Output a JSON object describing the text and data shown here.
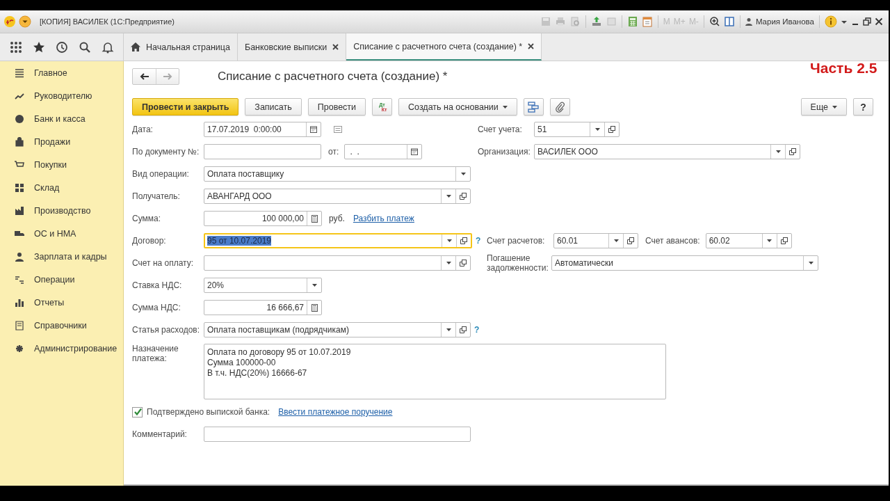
{
  "app": {
    "title": "[КОПИЯ] ВАСИЛЕК  (1С:Предприятие)",
    "memory": [
      "M",
      "M+",
      "M-"
    ],
    "user": "Мария Иванова"
  },
  "tabs": [
    {
      "label": "Начальная страница",
      "selected": false,
      "kind": "home"
    },
    {
      "label": "Банковские выписки",
      "selected": false,
      "kind": "closable"
    },
    {
      "label": "Списание с расчетного счета (создание) *",
      "selected": true,
      "kind": "closable"
    }
  ],
  "sidebar": {
    "items": [
      "Главное",
      "Руководителю",
      "Банк и касса",
      "Продажи",
      "Покупки",
      "Склад",
      "Производство",
      "ОС и НМА",
      "Зарплата и кадры",
      "Операции",
      "Отчеты",
      "Справочники",
      "Администрирование"
    ]
  },
  "overlay_caption": "Часть 2.5",
  "form": {
    "title": "Списание с расчетного счета (создание) *",
    "toolbar": [
      {
        "kind": "primary",
        "label": "Провести и закрыть"
      },
      {
        "kind": "button",
        "label": "Записать"
      },
      {
        "kind": "button",
        "label": "Провести"
      },
      {
        "kind": "dtkt",
        "top": "Дт",
        "bottom": "Кт"
      },
      {
        "kind": "menu",
        "label": "Создать на основании"
      },
      {
        "kind": "structure"
      },
      {
        "kind": "attach"
      }
    ],
    "toolbar_right": [
      {
        "kind": "menu",
        "label": "Еще"
      },
      {
        "kind": "button",
        "label": "?"
      }
    ],
    "rows": [
      {
        "left": [
          {
            "kind": "label",
            "text": "Дата:"
          },
          {
            "kind": "date",
            "value": "17.07.2019  0:00:00",
            "focused": false
          },
          {
            "kind": "note_icon"
          }
        ],
        "right": [
          {
            "kind": "label",
            "text": "Счет учета:"
          },
          {
            "kind": "reference",
            "value": "51",
            "focused": false
          }
        ]
      },
      {
        "left": [
          {
            "kind": "label",
            "text": "По документу №:"
          },
          {
            "kind": "text",
            "focused": false
          },
          {
            "kind": "label",
            "text": "от:"
          },
          {
            "kind": "date",
            "value": " .  . ",
            "focused": false
          }
        ],
        "right": [
          {
            "kind": "label",
            "text": "Организация:"
          },
          {
            "kind": "reference",
            "value": "ВАСИЛЕК ООО",
            "focused": false
          }
        ]
      },
      {
        "left": [
          {
            "kind": "label",
            "text": "Вид операции:"
          },
          {
            "kind": "select",
            "value": "Оплата поставщику",
            "focused": false
          }
        ]
      },
      {
        "left": [
          {
            "kind": "label",
            "text": "Получатель:"
          },
          {
            "kind": "reference",
            "value": "АВАНГАРД ООО",
            "focused": false
          }
        ]
      },
      {
        "left": [
          {
            "kind": "label",
            "text": "Сумма:"
          },
          {
            "kind": "number",
            "value": "100 000,00",
            "focused": false
          },
          {
            "kind": "unit",
            "text": "руб."
          },
          {
            "kind": "link",
            "text": "Разбить платеж"
          }
        ]
      },
      {
        "left": [
          {
            "kind": "label",
            "text": "Договор:"
          },
          {
            "kind": "reference",
            "value": "95 от 10.07.2019",
            "focused": true
          },
          {
            "kind": "help",
            "text": "?"
          }
        ],
        "right": [
          {
            "kind": "label",
            "text": "Счет расчетов:"
          },
          {
            "kind": "reference",
            "value": "60.01",
            "focused": false
          },
          {
            "kind": "label",
            "text": "Счет авансов:"
          },
          {
            "kind": "reference",
            "value": "60.02",
            "focused": false
          }
        ]
      },
      {
        "left": [
          {
            "kind": "label",
            "text": "Счет на оплату:"
          },
          {
            "kind": "reference",
            "focused": false
          }
        ],
        "right": [
          {
            "kind": "label",
            "text": "Погашение задолженности:"
          },
          {
            "kind": "select",
            "value": "Автоматически",
            "focused": false
          }
        ]
      },
      {
        "left": [
          {
            "kind": "label",
            "text": "Ставка НДС:"
          },
          {
            "kind": "select",
            "value": "20%",
            "focused": false
          }
        ]
      },
      {
        "left": [
          {
            "kind": "label",
            "text": "Сумма НДС:"
          },
          {
            "kind": "number",
            "value": "16 666,67",
            "focused": false
          }
        ]
      },
      {
        "left": [
          {
            "kind": "label",
            "text": "Статья расходов:"
          },
          {
            "kind": "reference",
            "value": "Оплата поставщикам (подрядчикам)",
            "focused": false
          },
          {
            "kind": "help",
            "text": "?"
          }
        ]
      },
      {
        "left": [
          {
            "kind": "label",
            "text": "Назначение платежа:"
          },
          {
            "kind": "textarea",
            "value": "Оплата по договору 95 от 10.07.2019\nСумма 100000-00\nВ т.ч. НДС(20%) 16666-67",
            "focused": false
          }
        ]
      },
      {
        "left": [
          {
            "kind": "checkbox",
            "label": "Подтверждено выпиской банка:",
            "checked": true
          },
          {
            "kind": "link",
            "text": "Ввести платежное поручение"
          }
        ]
      },
      {
        "left": [
          {
            "kind": "label",
            "text": "Комментарий:"
          },
          {
            "kind": "text",
            "focused": false
          }
        ]
      }
    ]
  }
}
